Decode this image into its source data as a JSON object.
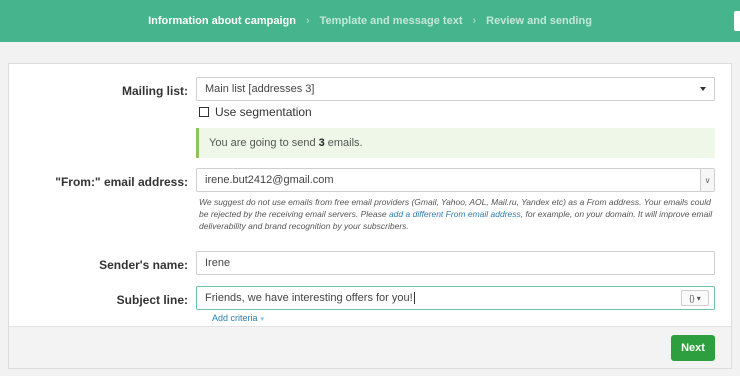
{
  "steps": {
    "step1": "Information about campaign",
    "step2": "Template and message text",
    "step3": "Review and sending",
    "separator": "›"
  },
  "form": {
    "mailing_list_label": "Mailing list:",
    "mailing_list_value": "Main list [addresses 3]",
    "segmentation_label": "Use segmentation",
    "segmentation_checked": false,
    "info_prefix": "You are going to send",
    "info_count": "3",
    "info_suffix": "emails.",
    "from_label": "\"From:\" email address:",
    "from_value": "irene.but2412@gmail.com",
    "hint_part1": "We suggest do not use emails from free email providers (Gmail, Yahoo, AOL, Mail.ru, Yandex etc) as a From address. Your emails could be rejected by the receiving email servers. Please",
    "hint_link": "add a different From email address",
    "hint_part2": ", for example, on your domain. It will improve email deliverability and brand recognition by your subscribers.",
    "sender_label": "Sender's name:",
    "sender_value": "Irene",
    "subject_label": "Subject line:",
    "subject_value": "Friends, we have interesting offers for you!",
    "var_button_label": "{}",
    "add_criteria_label": "Add criteria"
  },
  "footer": {
    "next_label": "Next"
  },
  "colors": {
    "header_bg": "#46b48c",
    "next_button": "#2e9f3f",
    "info_bg": "#eef7e8",
    "info_border": "#8cc35a",
    "link": "#2a7fb0"
  }
}
